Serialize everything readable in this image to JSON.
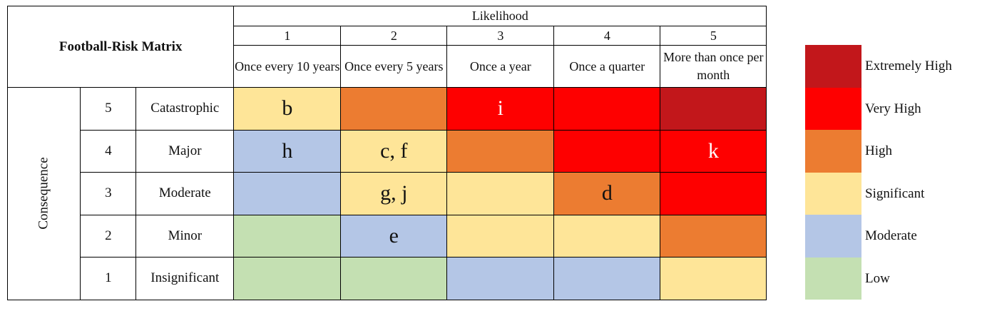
{
  "title": "Football-Risk Matrix",
  "likelihood_label": "Likelihood",
  "consequence_label": "Consequence",
  "colors": {
    "Extremely High": "#c2171b",
    "Very High": "#fe0000",
    "High": "#ec7c31",
    "Significant": "#fee598",
    "Moderate": "#b4c6e6",
    "Low": "#c4e0b2"
  },
  "likelihood": [
    {
      "level": "1",
      "desc": "Once every 10 years"
    },
    {
      "level": "2",
      "desc": "Once every 5 years"
    },
    {
      "level": "3",
      "desc": "Once a year"
    },
    {
      "level": "4",
      "desc": "Once a quarter"
    },
    {
      "level": "5",
      "desc": "More than once per month"
    }
  ],
  "consequence": [
    {
      "level": "5",
      "desc": "Catastrophic",
      "cells": [
        {
          "rating": "Significant",
          "label": "b"
        },
        {
          "rating": "High",
          "label": ""
        },
        {
          "rating": "Very High",
          "label": "i"
        },
        {
          "rating": "Very High",
          "label": ""
        },
        {
          "rating": "Extremely High",
          "label": ""
        }
      ]
    },
    {
      "level": "4",
      "desc": "Major",
      "cells": [
        {
          "rating": "Moderate",
          "label": "h"
        },
        {
          "rating": "Significant",
          "label": "c, f"
        },
        {
          "rating": "High",
          "label": ""
        },
        {
          "rating": "Very High",
          "label": ""
        },
        {
          "rating": "Very High",
          "label": "k"
        }
      ]
    },
    {
      "level": "3",
      "desc": "Moderate",
      "cells": [
        {
          "rating": "Moderate",
          "label": ""
        },
        {
          "rating": "Significant",
          "label": "g, j"
        },
        {
          "rating": "Significant",
          "label": ""
        },
        {
          "rating": "High",
          "label": "d"
        },
        {
          "rating": "Very High",
          "label": ""
        }
      ]
    },
    {
      "level": "2",
      "desc": "Minor",
      "cells": [
        {
          "rating": "Low",
          "label": ""
        },
        {
          "rating": "Moderate",
          "label": "e"
        },
        {
          "rating": "Significant",
          "label": ""
        },
        {
          "rating": "Significant",
          "label": ""
        },
        {
          "rating": "High",
          "label": ""
        }
      ]
    },
    {
      "level": "1",
      "desc": "Insignificant",
      "cells": [
        {
          "rating": "Low",
          "label": ""
        },
        {
          "rating": "Low",
          "label": ""
        },
        {
          "rating": "Moderate",
          "label": ""
        },
        {
          "rating": "Moderate",
          "label": ""
        },
        {
          "rating": "Significant",
          "label": ""
        }
      ]
    }
  ],
  "legend": [
    "Extremely High",
    "Very High",
    "High",
    "Significant",
    "Moderate",
    "Low"
  ]
}
